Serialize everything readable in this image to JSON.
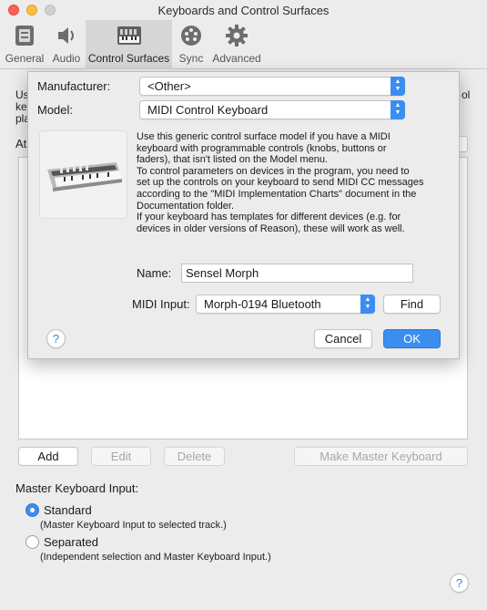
{
  "window": {
    "title": "Keyboards and Control Surfaces"
  },
  "toolbar": {
    "items": [
      {
        "label": "General",
        "icon": "general-icon"
      },
      {
        "label": "Audio",
        "icon": "speaker-icon"
      },
      {
        "label": "Control Surfaces",
        "icon": "control-surfaces-icon",
        "selected": true
      },
      {
        "label": "Sync",
        "icon": "sync-icon"
      },
      {
        "label": "Advanced",
        "icon": "gear-icon"
      }
    ]
  },
  "background": {
    "intro_fragments": [
      "Us",
      "ke",
      "pla"
    ],
    "intro_right_fragments": [
      "ol"
    ],
    "attached_label_fragment": "At",
    "buttons": {
      "add": "Add",
      "edit": "Edit",
      "delete": "Delete",
      "make_master": "Make Master Keyboard"
    },
    "master_input_label": "Master Keyboard Input:",
    "radios": [
      {
        "label": "Standard",
        "sublabel": "(Master Keyboard Input to selected track.)",
        "selected": true
      },
      {
        "label": "Separated",
        "sublabel": "(Independent selection and Master Keyboard Input.)",
        "selected": false
      }
    ],
    "help": "?"
  },
  "sheet": {
    "manufacturer_label": "Manufacturer:",
    "manufacturer_value": "<Other>",
    "model_label": "Model:",
    "model_value": "MIDI Control Keyboard",
    "description": [
      "Use this generic control surface model if you have a MIDI",
      "keyboard with programmable controls (knobs, buttons or",
      "faders), that isn't listed on the Model menu.",
      "To control parameters on devices in the program, you need to",
      "set up the controls on your keyboard to send MIDI CC messages",
      "according to the \"MIDI Implementation Charts\" document in the",
      "Documentation folder.",
      "If your keyboard has templates for different devices (e.g. for",
      "devices in older versions of Reason), these will work as well."
    ],
    "name_label": "Name:",
    "name_value": "Sensel Morph",
    "midi_input_label": "MIDI Input:",
    "midi_input_value": "Morph-0194 Bluetooth",
    "find_label": "Find",
    "help": "?",
    "cancel_label": "Cancel",
    "ok_label": "OK"
  },
  "colors": {
    "accent": "#3b8ef0",
    "window_bg": "#ececec"
  }
}
